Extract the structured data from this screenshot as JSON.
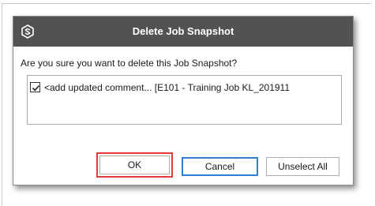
{
  "background": {
    "partial_text_left": "ˑˑˑˑˑˑ",
    "partial_text_right": "ˑˑˑˑˑˑˑˑ"
  },
  "dialog": {
    "title": "Delete Job Snapshot",
    "logo_icon": "app-logo-icon",
    "prompt": "Are you sure you want to delete this Job Snapshot?",
    "items": [
      {
        "checked": true,
        "label": "<add updated comment... [E101 - Training Job KL_201911"
      }
    ],
    "buttons": {
      "ok": "OK",
      "cancel": "Cancel",
      "unselect_all": "Unselect All"
    }
  },
  "colors": {
    "titlebar": "#525252",
    "ok_highlight": "#e23b3b",
    "cancel_focus": "#2f7fd1"
  }
}
